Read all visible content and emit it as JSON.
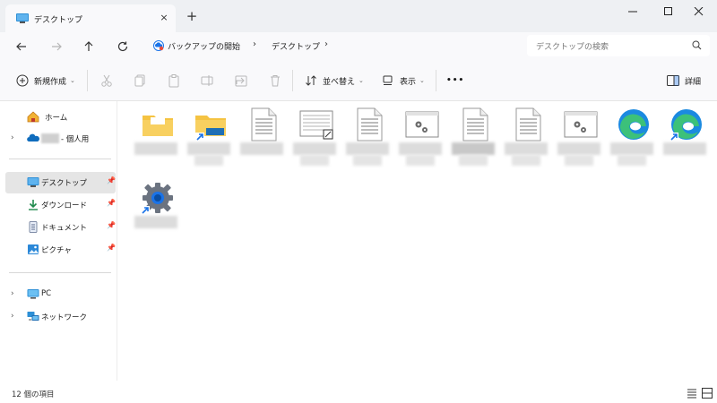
{
  "window": {
    "tab_title": "デスクトップ",
    "tab_close": "×",
    "new_tab": "+"
  },
  "navigation": {
    "breadcrumb": [
      "バックアップの開始",
      "デスクトップ"
    ],
    "breadcrumb_sep": "›",
    "search_placeholder": "デスクトップの検索"
  },
  "toolbar": {
    "new_label": "新規作成",
    "sort_label": "並べ替え",
    "view_label": "表示",
    "more_label": "•••",
    "details_label": "詳細"
  },
  "sidebar": {
    "home": "ホーム",
    "personal_suffix": "- 個人用",
    "quick_access": [
      {
        "label": "デスクトップ",
        "pinned": true,
        "selected": true
      },
      {
        "label": "ダウンロード",
        "pinned": true
      },
      {
        "label": "ドキュメント",
        "pinned": true
      },
      {
        "label": "ピクチャ",
        "pinned": true
      }
    ],
    "pc": "PC",
    "network": "ネットワーク"
  },
  "files": [
    {
      "icon": "folder-icon",
      "shortcut": false
    },
    {
      "icon": "folder-icon",
      "shortcut": true
    },
    {
      "icon": "text-document-icon",
      "shortcut": false
    },
    {
      "icon": "data-file-icon",
      "shortcut": false
    },
    {
      "icon": "text-document-icon",
      "shortcut": false
    },
    {
      "icon": "settings-file-icon",
      "shortcut": false
    },
    {
      "icon": "text-document-icon",
      "shortcut": false
    },
    {
      "icon": "text-document-icon",
      "shortcut": false
    },
    {
      "icon": "settings-file-icon",
      "shortcut": false
    },
    {
      "icon": "edge-icon",
      "shortcut": false
    },
    {
      "icon": "edge-icon",
      "shortcut": true
    },
    {
      "icon": "settings-gear-icon",
      "shortcut": true
    }
  ],
  "status": {
    "item_count": "12 個の項目"
  },
  "colors": {
    "accent": "#0067c0",
    "folder": "#f5c342",
    "edge_blue": "#1b8ae0",
    "edge_green": "#3cc17a"
  }
}
